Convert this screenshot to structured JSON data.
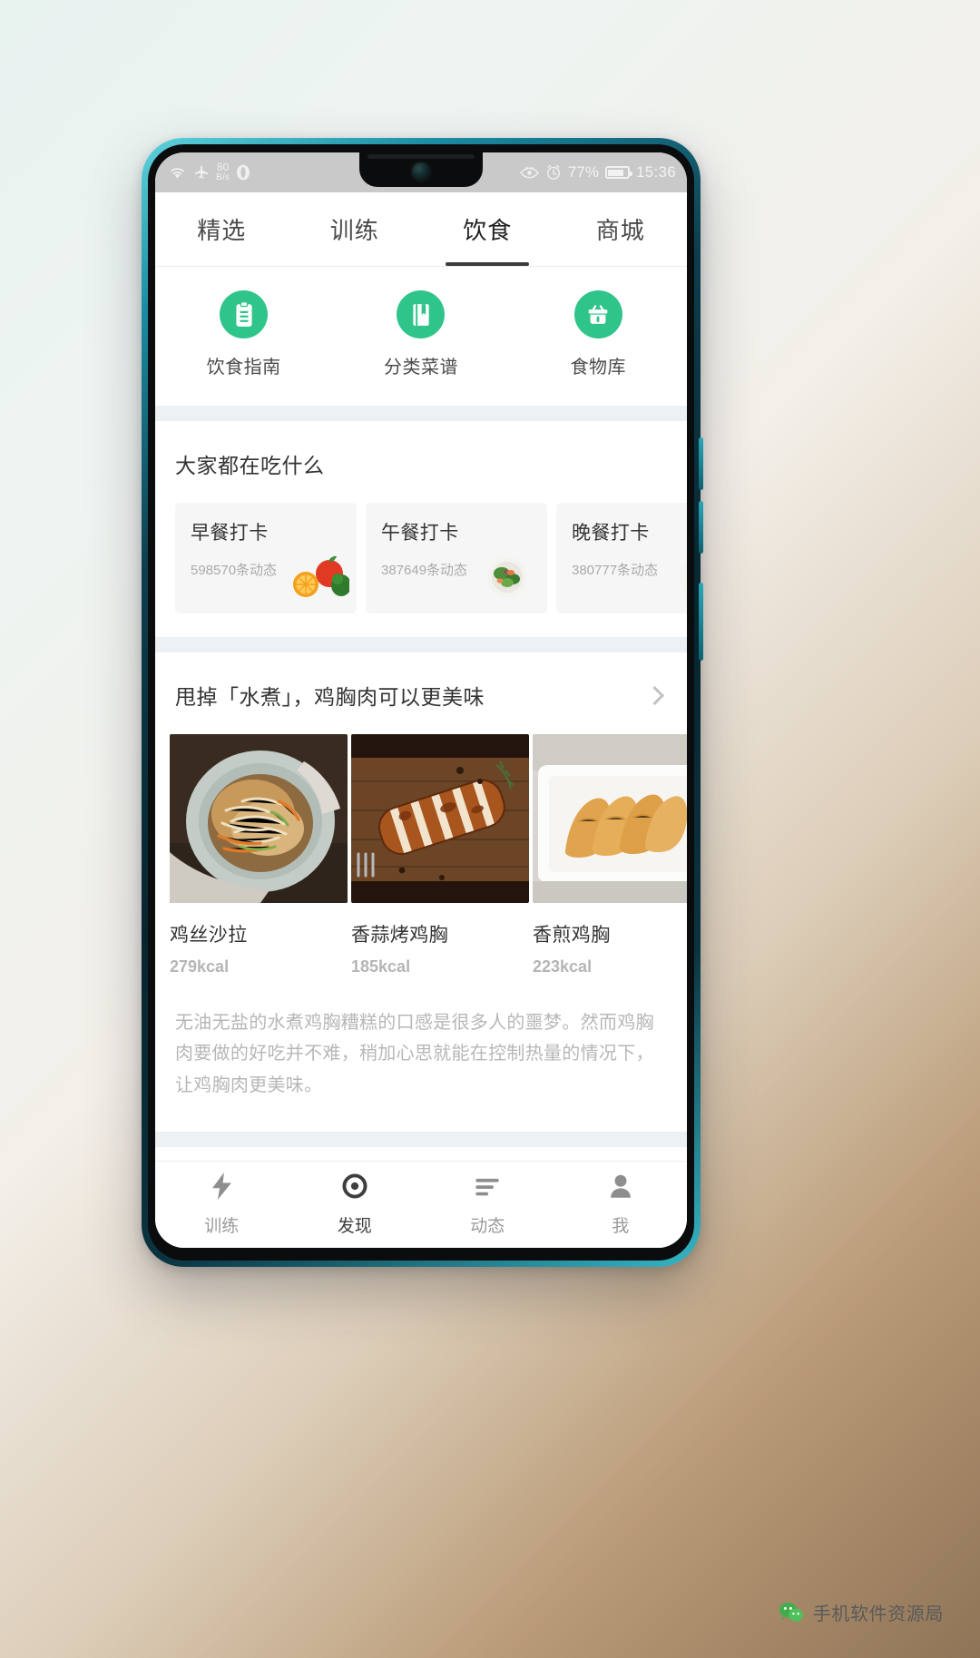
{
  "statusbar": {
    "icons": [
      "wifi-icon",
      "airplane-mode-icon",
      "opera-icon",
      "eye-comfort-icon",
      "alarm-icon"
    ],
    "net_speed_value": "80",
    "net_speed_unit": "B/s",
    "battery_percent": "77%",
    "clock": "15:36"
  },
  "tabs": [
    {
      "label": "精选",
      "active": false
    },
    {
      "label": "训练",
      "active": false
    },
    {
      "label": "饮食",
      "active": true
    },
    {
      "label": "商城",
      "active": false
    }
  ],
  "quick_entries": [
    {
      "label": "饮食指南",
      "icon": "clipboard-icon"
    },
    {
      "label": "分类菜谱",
      "icon": "book-icon"
    },
    {
      "label": "食物库",
      "icon": "basket-icon"
    }
  ],
  "eating_section": {
    "title": "大家都在吃什么",
    "cards": [
      {
        "name": "早餐打卡",
        "count": "598570条动态",
        "thumb": "fruit-veg-thumb"
      },
      {
        "name": "午餐打卡",
        "count": "387649条动态",
        "thumb": "salad-bowl-thumb"
      },
      {
        "name": "晚餐打卡",
        "count": "380777条动态",
        "thumb": "salad-plate-thumb"
      }
    ]
  },
  "article": {
    "title": "甩掉「水煮」，鸡胸肉可以更美味",
    "more_icon": "chevron-right-icon",
    "recipes": [
      {
        "name": "鸡丝沙拉",
        "kcal": "279kcal",
        "image": "shredded-chicken-salad-photo"
      },
      {
        "name": "香蒜烤鸡胸",
        "kcal": "185kcal",
        "image": "garlic-roast-chicken-photo"
      },
      {
        "name": "香煎鸡胸",
        "kcal": "223kcal",
        "image": "pan-fried-chicken-photo"
      }
    ],
    "description": "无油无盐的水煮鸡胸糟糕的口感是很多人的噩梦。然而鸡胸肉要做的好吃并不难，稍加心思就能在控制热量的情况下，让鸡胸肉更美味。"
  },
  "bottom_nav": [
    {
      "label": "训练",
      "icon": "lightning-icon",
      "active": false
    },
    {
      "label": "发现",
      "icon": "circle-icon",
      "active": true
    },
    {
      "label": "动态",
      "icon": "lines-icon",
      "active": false
    },
    {
      "label": "我",
      "icon": "person-icon",
      "active": false
    }
  ],
  "watermark": {
    "text": "手机软件资源局",
    "icon": "wechat-logo-icon"
  },
  "colors": {
    "accent_green": "#2fc58a",
    "tab_indicator": "#3b3b3b",
    "statusbar_bg": "#c9c9c9"
  }
}
